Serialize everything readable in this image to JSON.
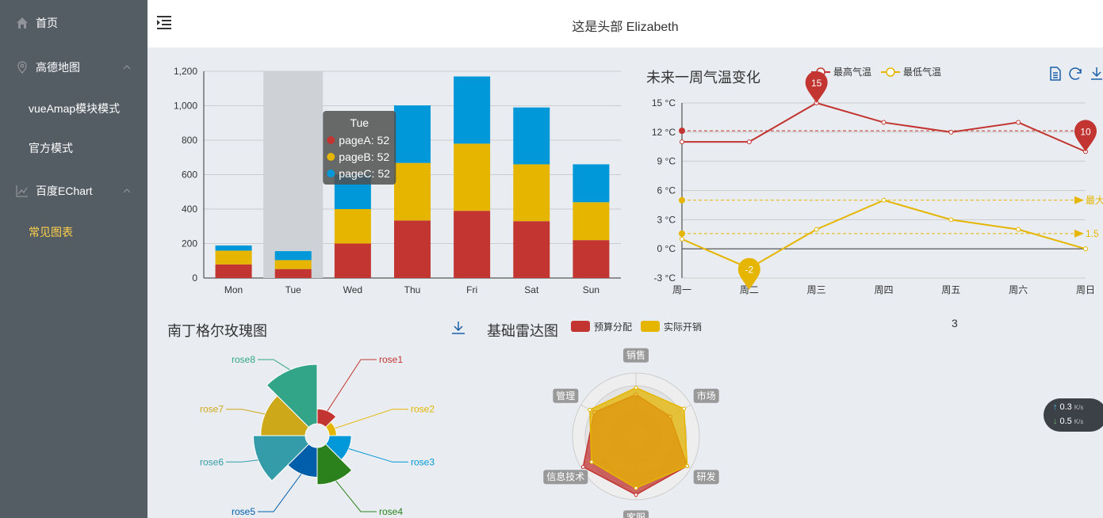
{
  "sidebar": {
    "items": [
      {
        "label": "首页",
        "icon": "home-icon"
      },
      {
        "label": "高德地图",
        "icon": "location-icon"
      },
      {
        "label": "vueAmap模块模式"
      },
      {
        "label": "官方模式"
      },
      {
        "label": "百度EChart",
        "icon": "chart-line-icon"
      },
      {
        "label": "常见图表"
      }
    ],
    "active_color": "#ffd04b",
    "bg_color": "#545c64"
  },
  "header": {
    "title": "这是头部 Elizabeth",
    "toggle_icon": "menu-fold-icon"
  },
  "chart_data": [
    {
      "type": "bar",
      "stacked": true,
      "categories": [
        "Mon",
        "Tue",
        "Wed",
        "Thu",
        "Fri",
        "Sat",
        "Sun"
      ],
      "series": [
        {
          "name": "pageA",
          "color": "#c23531",
          "values": [
            79,
            52,
            200,
            334,
            390,
            330,
            220
          ]
        },
        {
          "name": "pageB",
          "color": "#e5b500",
          "values": [
            80,
            52,
            200,
            334,
            390,
            330,
            220
          ]
        },
        {
          "name": "pageC",
          "color": "#0098d9",
          "values": [
            30,
            52,
            200,
            334,
            390,
            330,
            220
          ]
        }
      ],
      "ylim": [
        0,
        1200
      ],
      "yticks": [
        "0",
        "200",
        "400",
        "600",
        "800",
        "1,000",
        "1,200"
      ],
      "highlight_category": "Tue",
      "tooltip": {
        "title": "Tue",
        "lines": [
          "pageA: 52",
          "pageB: 52",
          "pageC: 52"
        ]
      }
    },
    {
      "type": "line",
      "title": "未来一周气温变化",
      "categories": [
        "周一",
        "周二",
        "周三",
        "周四",
        "周五",
        "周六",
        "周日"
      ],
      "series": [
        {
          "name": "最高气温",
          "color": "#c23531",
          "values": [
            11,
            11,
            15,
            13,
            12,
            13,
            10
          ]
        },
        {
          "name": "最低气温",
          "color": "#e5b500",
          "values": [
            1,
            -2,
            2,
            5,
            3,
            2,
            0
          ]
        }
      ],
      "ylim": [
        -3,
        15
      ],
      "yticks": [
        "-3 °C",
        "0 °C",
        "3 °C",
        "6 °C",
        "9 °C",
        "12 °C",
        "15 °C"
      ],
      "markpoints": [
        {
          "series": 0,
          "index": 2,
          "value": "15"
        },
        {
          "series": 0,
          "index": 6,
          "value": "10"
        },
        {
          "series": 1,
          "index": 1,
          "value": "-2"
        }
      ],
      "marklines": [
        {
          "series": 0,
          "value": 12.14
        },
        {
          "series": 1,
          "value": 1.57,
          "label": "1.5"
        },
        {
          "series": 1,
          "value": 5,
          "label": "最大值"
        }
      ],
      "toolbox": [
        "data-view-icon",
        "refresh-icon",
        "download-icon"
      ]
    },
    {
      "type": "pie",
      "rose": true,
      "title": "南丁格尔玫瑰图",
      "categories": [
        "rose1",
        "rose2",
        "rose3",
        "rose4",
        "rose5",
        "rose6",
        "rose7",
        "rose8"
      ],
      "values": [
        10,
        5,
        15,
        25,
        20,
        35,
        30,
        40
      ],
      "colors": [
        "#c23531",
        "#e5b500",
        "#0098d9",
        "#2b821d",
        "#005eaa",
        "#339ca8",
        "#cda819",
        "#32a487"
      ],
      "toolbox": [
        "download-icon"
      ]
    },
    {
      "type": "radar",
      "title": "基础雷达图",
      "indicators": [
        "销售",
        "市场",
        "研发",
        "客服",
        "信息技术",
        "管理"
      ],
      "max": [
        6500,
        16000,
        30000,
        38000,
        52000,
        25000
      ],
      "series": [
        {
          "name": "预算分配",
          "color": "#c23531",
          "values": [
            4300,
            10000,
            28000,
            35000,
            50000,
            19000
          ]
        },
        {
          "name": "实际开销",
          "color": "#e5b500",
          "values": [
            5000,
            14000,
            28000,
            31000,
            42000,
            21000
          ]
        }
      ]
    }
  ],
  "page_counter": "3",
  "network": {
    "up": "0.3",
    "down": "0.5",
    "unit": "K/s"
  }
}
